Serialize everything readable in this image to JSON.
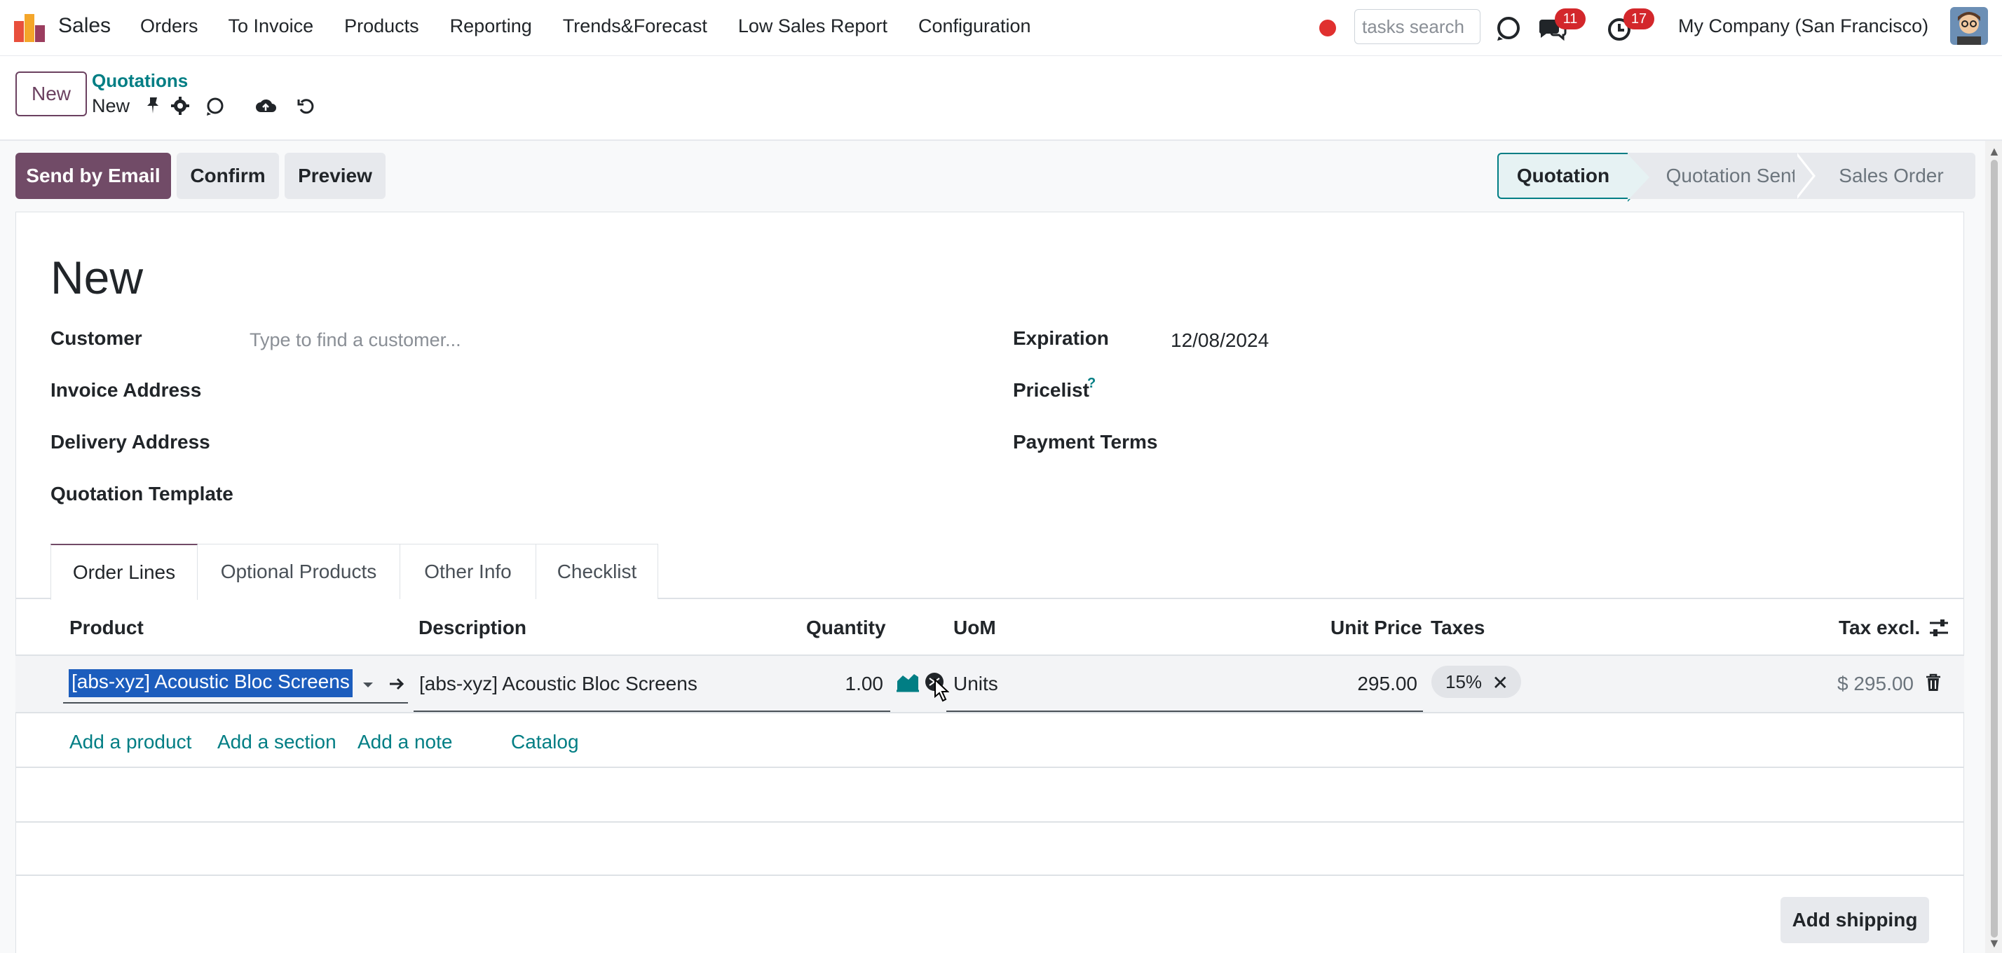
{
  "app": {
    "name": "Sales",
    "menu": [
      "Orders",
      "To Invoice",
      "Products",
      "Reporting",
      "Trends&Forecast",
      "Low Sales Report",
      "Configuration"
    ],
    "search_placeholder": "tasks search",
    "messages_count": "11",
    "activities_count": "17",
    "company": "My Company (San Francisco)"
  },
  "control": {
    "new_button": "New",
    "breadcrumb_parent": "Quotations",
    "breadcrumb_current": "New"
  },
  "actions": {
    "send_email": "Send by Email",
    "confirm": "Confirm",
    "preview": "Preview"
  },
  "status": {
    "stages": [
      "Quotation",
      "Quotation Sent",
      "Sales Order"
    ],
    "active": "Quotation"
  },
  "form": {
    "title": "New",
    "customer_label": "Customer",
    "customer_placeholder": "Type to find a customer...",
    "invoice_address_label": "Invoice Address",
    "delivery_address_label": "Delivery Address",
    "quotation_template_label": "Quotation Template",
    "expiration_label": "Expiration",
    "expiration_value": "12/08/2024",
    "pricelist_label": "Pricelist",
    "pricelist_help": "?",
    "payment_terms_label": "Payment Terms"
  },
  "tabs": [
    "Order Lines",
    "Optional Products",
    "Other Info",
    "Checklist"
  ],
  "order_lines": {
    "headers": {
      "product": "Product",
      "description": "Description",
      "quantity": "Quantity",
      "uom": "UoM",
      "unit_price": "Unit Price",
      "taxes": "Taxes",
      "tax_excl": "Tax excl."
    },
    "rows": [
      {
        "product": "[abs-xyz] Acoustic Bloc Screens",
        "description": "[abs-xyz] Acoustic Bloc Screens",
        "quantity": "1.00",
        "uom": "Units",
        "unit_price": "295.00",
        "tax": "15%",
        "subtotal": "$ 295.00"
      }
    ],
    "links": {
      "add_product": "Add a product",
      "add_section": "Add a section",
      "add_note": "Add a note",
      "catalog": "Catalog"
    }
  },
  "footer": {
    "add_shipping": "Add shipping"
  },
  "colors": {
    "primary": "#714b67",
    "link": "#017e84",
    "badge": "#d3272b",
    "selection": "#1c5dbd"
  }
}
